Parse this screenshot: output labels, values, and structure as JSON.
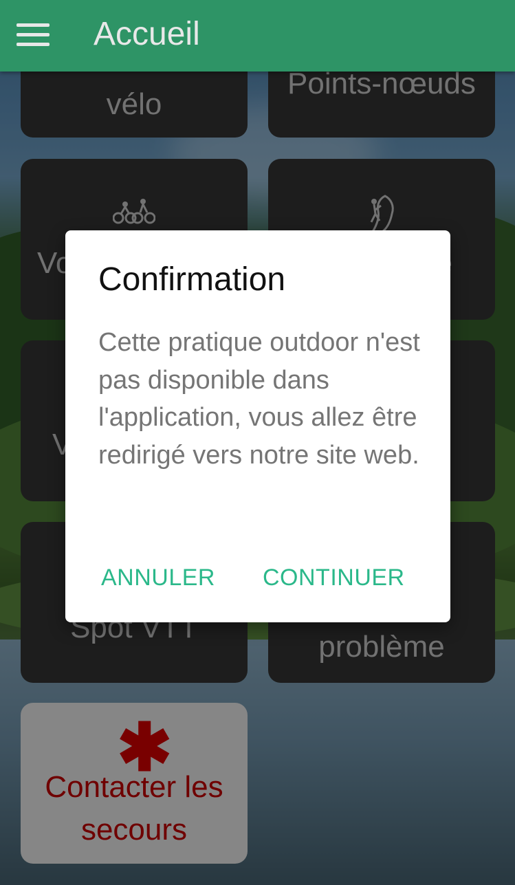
{
  "appbar": {
    "title": "Accueil",
    "menu_icon": "hamburger-menu-icon",
    "color": "#2e9466"
  },
  "tiles": {
    "velo_label": "vélo",
    "points_noeuds_label": "Points-nœuds",
    "vtt_label": "Vo",
    "escalade_label": "e",
    "rando_label": "V",
    "spot_vtt_label": "Spot VTT",
    "probleme_label": "n\nproblème",
    "velo_icon": "cyclists-icon",
    "escalade_icon": "climber-icon"
  },
  "sos": {
    "icon": "asterisk-icon",
    "symbol": "✱",
    "label": "Contacter les\nsecours",
    "color": "#c00000"
  },
  "dialog": {
    "title": "Confirmation",
    "message": "Cette pratique outdoor n'est pas disponible dans l'application, vous allez être redirigé vers notre site web.",
    "cancel_label": "ANNULER",
    "continue_label": "CONTINUER",
    "accent": "#2bb88a"
  }
}
